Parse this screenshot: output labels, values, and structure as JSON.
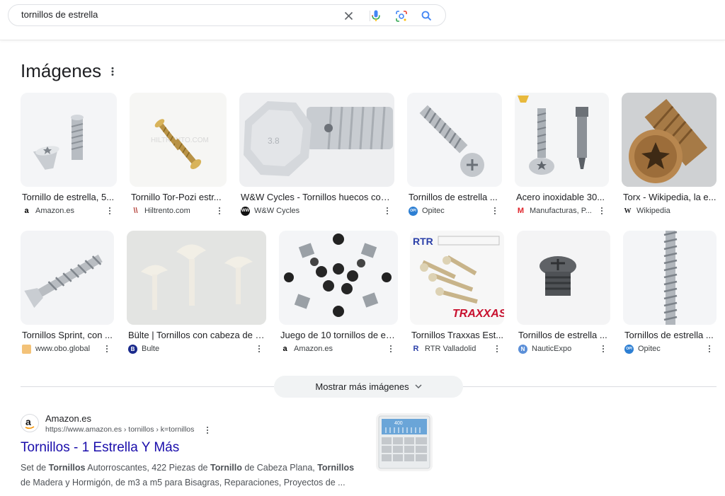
{
  "search": {
    "query": "tornillos de estrella",
    "icons": [
      "close-icon",
      "microphone-icon",
      "lens-icon",
      "search-icon"
    ]
  },
  "images_section": {
    "title": "Imágenes",
    "row1": [
      {
        "caption": "Tornillo de estrella, 5...",
        "source": "Amazon.es",
        "fav_color": "#000000",
        "fav_letter": "a"
      },
      {
        "caption": "Tornillo Tor-Pozi estr...",
        "source": "Hiltrento.com",
        "fav_color": "#b5423a",
        "fav_letter": "\\"
      },
      {
        "caption": "W&W Cycles - Tornillos huecos con ...",
        "source": "W&W Cycles",
        "fav_color": "#111111",
        "fav_letter": "W"
      },
      {
        "caption": "Tornillos de estrella ...",
        "source": "Opitec",
        "fav_color": "#2d7fd3",
        "fav_letter": "o"
      },
      {
        "caption": "Acero inoxidable 30...",
        "source": "Manufacturas, P...",
        "fav_color": "#e0242b",
        "fav_letter": "M"
      },
      {
        "caption": "Torx - Wikipedia, la e...",
        "source": "Wikipedia",
        "fav_color": "#ffffff",
        "fav_letter": "W"
      }
    ],
    "row2": [
      {
        "caption": "Tornillos Sprint, con ...",
        "source": "www.obo.global",
        "fav_color": "#f0a040",
        "fav_letter": "▭"
      },
      {
        "caption": "Bülte | Tornillos con cabeza de e...",
        "source": "Bulte",
        "fav_color": "#1a2a8c",
        "fav_letter": "B"
      },
      {
        "caption": "Juego de 10 tornillos de es...",
        "source": "Amazon.es",
        "fav_color": "#000000",
        "fav_letter": "a"
      },
      {
        "caption": "Tornillos Traxxas Est...",
        "source": "RTR Valladolid",
        "fav_color": "#2a3fa8",
        "fav_letter": "R"
      },
      {
        "caption": "Tornillos de estrella ...",
        "source": "NauticExpo",
        "fav_color": "#5b8fd8",
        "fav_letter": "N"
      },
      {
        "caption": "Tornillos de estrella ...",
        "source": "Opitec",
        "fav_color": "#2d7fd3",
        "fav_letter": "o"
      }
    ],
    "more_button": "Mostrar más imágenes"
  },
  "result": {
    "site": "Amazon.es",
    "url": "https://www.amazon.es › tornillos › k=tornillos",
    "title": "Tornillos - 1 Estrella Y Más",
    "snippet_parts": [
      "Set de ",
      "Tornillos",
      " Autorroscantes, 422 Piezas de ",
      "Tornillo",
      " de Cabeza Plana, ",
      "Tornillos",
      " de Madera y Hormigón, de m3 a m5 para Bisagras, Reparaciones, Proyectos de ..."
    ],
    "thumb_label": "400"
  }
}
